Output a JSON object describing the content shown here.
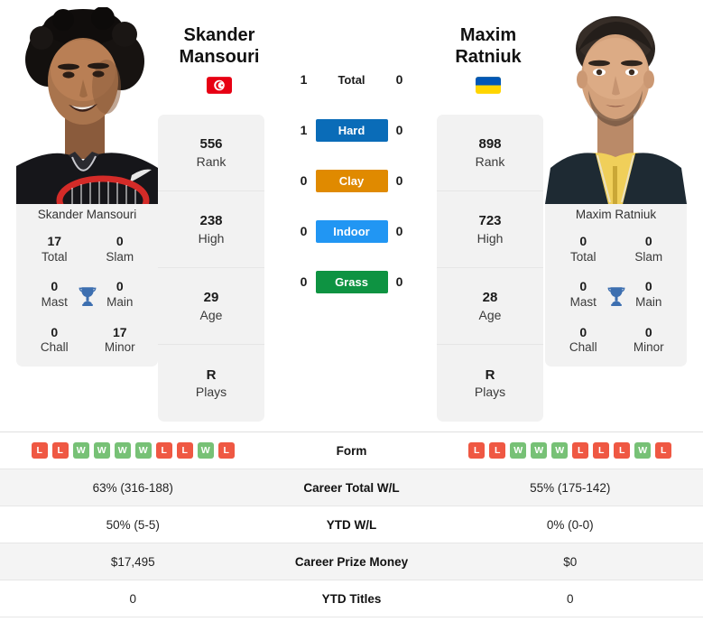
{
  "players": {
    "left": {
      "first_name": "Skander",
      "last_name": "Mansouri",
      "full_name": "Skander Mansouri",
      "country": "Tunisia",
      "flag_icon": "tunisia-flag-icon",
      "rank": "556",
      "rank_label": "Rank",
      "high": "238",
      "high_label": "High",
      "age": "29",
      "age_label": "Age",
      "plays": "R",
      "plays_label": "Plays",
      "titles": {
        "total": "17",
        "total_label": "Total",
        "slam": "0",
        "slam_label": "Slam",
        "mast": "0",
        "mast_label": "Mast",
        "main": "0",
        "main_label": "Main",
        "chall": "0",
        "chall_label": "Chall",
        "minor": "17",
        "minor_label": "Minor"
      },
      "form": [
        "L",
        "L",
        "W",
        "W",
        "W",
        "W",
        "L",
        "L",
        "W",
        "L"
      ],
      "career_total_wl": "63% (316-188)",
      "ytd_wl": "50% (5-5)",
      "career_prize_money": "$17,495",
      "ytd_titles": "0"
    },
    "right": {
      "first_name": "Maxim",
      "last_name": "Ratniuk",
      "full_name": "Maxim Ratniuk",
      "country": "Ukraine",
      "flag_icon": "ukraine-flag-icon",
      "rank": "898",
      "rank_label": "Rank",
      "high": "723",
      "high_label": "High",
      "age": "28",
      "age_label": "Age",
      "plays": "R",
      "plays_label": "Plays",
      "titles": {
        "total": "0",
        "total_label": "Total",
        "slam": "0",
        "slam_label": "Slam",
        "mast": "0",
        "mast_label": "Mast",
        "main": "0",
        "main_label": "Main",
        "chall": "0",
        "chall_label": "Chall",
        "minor": "0",
        "minor_label": "Minor"
      },
      "form": [
        "L",
        "L",
        "W",
        "W",
        "W",
        "L",
        "L",
        "L",
        "W",
        "L"
      ],
      "career_total_wl": "55% (175-142)",
      "ytd_wl": "0% (0-0)",
      "career_prize_money": "$0",
      "ytd_titles": "0"
    }
  },
  "head_to_head": [
    {
      "label": "Total",
      "left": "1",
      "right": "0",
      "color": "",
      "style": "plain"
    },
    {
      "label": "Hard",
      "left": "1",
      "right": "0",
      "color": "#0a6cb8",
      "style": "badge"
    },
    {
      "label": "Clay",
      "left": "0",
      "right": "0",
      "color": "#e08a00",
      "style": "badge"
    },
    {
      "label": "Indoor",
      "left": "0",
      "right": "0",
      "color": "#2196f3",
      "style": "badge"
    },
    {
      "label": "Grass",
      "left": "0",
      "right": "0",
      "color": "#0e9342",
      "style": "badge"
    }
  ],
  "table_rows": [
    {
      "label": "Form",
      "left": "",
      "right": "",
      "type": "form"
    },
    {
      "label": "Career Total W/L",
      "left": "63% (316-188)",
      "right": "55% (175-142)",
      "type": "text"
    },
    {
      "label": "YTD W/L",
      "left": "50% (5-5)",
      "right": "0% (0-0)",
      "type": "text"
    },
    {
      "label": "Career Prize Money",
      "left": "$17,495",
      "right": "$0",
      "type": "text"
    },
    {
      "label": "YTD Titles",
      "left": "0",
      "right": "0",
      "type": "text"
    }
  ],
  "colors": {
    "win": "#77c176",
    "loss": "#ef5843",
    "hard": "#0a6cb8",
    "clay": "#e08a00",
    "indoor": "#2196f3",
    "grass": "#0e9342",
    "trophy": "#3d6fb0",
    "card_bg": "#f2f2f2"
  }
}
